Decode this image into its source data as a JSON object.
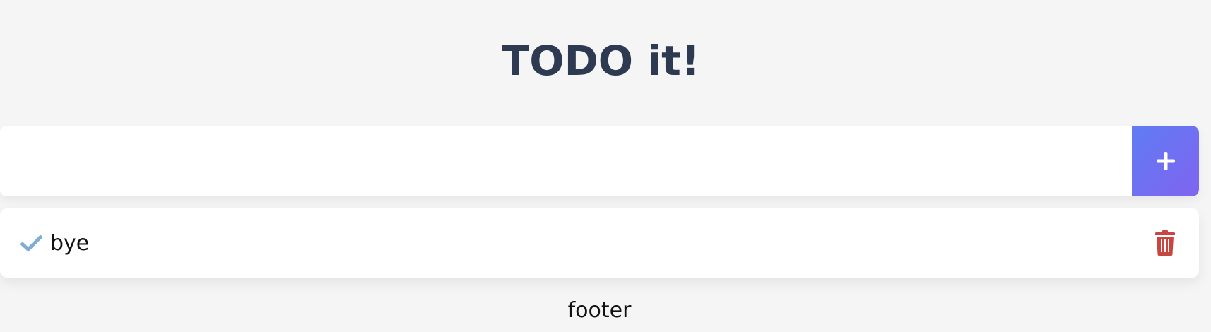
{
  "app": {
    "title": "TODO it!"
  },
  "add_form": {
    "input_value": "",
    "input_placeholder": "",
    "add_button_icon": "plus-icon"
  },
  "todos": [
    {
      "text": "bye",
      "completed": true,
      "check_icon": "checkmark-icon",
      "delete_icon": "trash-icon"
    }
  ],
  "footer": {
    "text": "footer"
  },
  "colors": {
    "title": "#2e3a52",
    "background": "#f5f5f5",
    "add_button_gradient_start": "#5f7cf5",
    "add_button_gradient_end": "#8064ef",
    "check": "#7eaed6",
    "delete": "#c8463f"
  }
}
